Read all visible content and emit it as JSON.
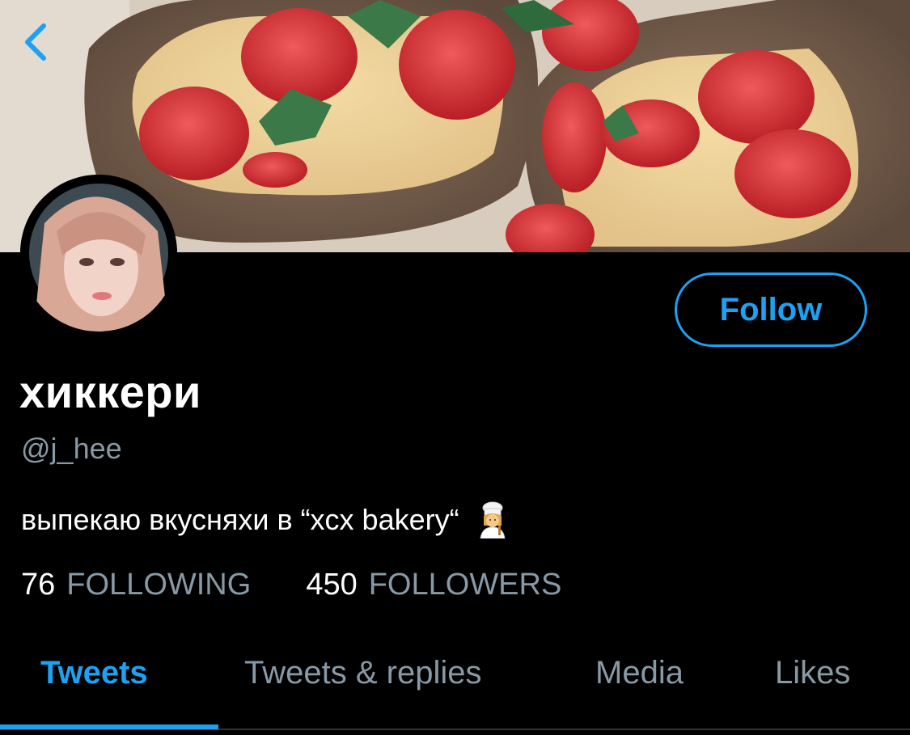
{
  "profile": {
    "display_name": "хиккери",
    "handle": "@j_hee",
    "bio": "выпекаю вкусняхи в “xcx bakery“",
    "bio_emoji": "woman-cook-emoji"
  },
  "actions": {
    "follow_label": "Follow"
  },
  "stats": {
    "following_count": "76",
    "following_label": "FOLLOWING",
    "followers_count": "450",
    "followers_label": "FOLLOWERS"
  },
  "tabs": [
    {
      "label": "Tweets",
      "active": true
    },
    {
      "label": "Tweets & replies",
      "active": false
    },
    {
      "label": "Media",
      "active": false
    },
    {
      "label": "Likes",
      "active": false
    }
  ],
  "icons": {
    "back": "chevron-left-icon"
  },
  "colors": {
    "accent": "#1da1f2",
    "secondary_text": "#8899a6",
    "background": "#000000"
  }
}
